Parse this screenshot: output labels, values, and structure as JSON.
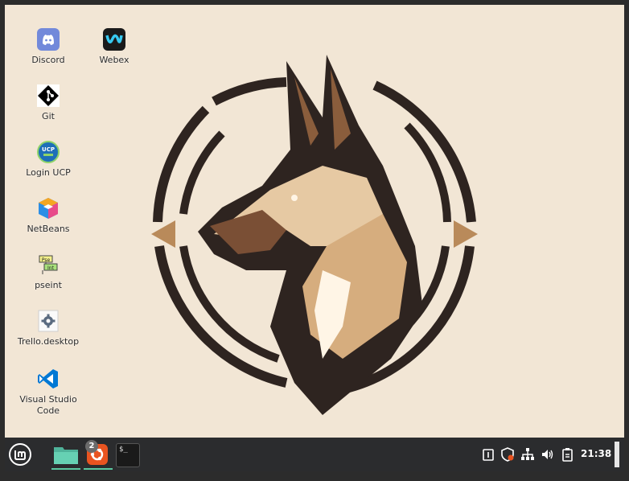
{
  "desktop_icons": [
    {
      "name": "discord-launcher",
      "icon": "discord-icon",
      "label": "Discord"
    },
    {
      "name": "webex-launcher",
      "icon": "webex-icon",
      "label": "Webex"
    },
    {
      "name": "git-launcher",
      "icon": "git-icon",
      "label": "Git"
    },
    {
      "name": "login-ucp-launcher",
      "icon": "ucp-icon",
      "label": "Login UCP"
    },
    {
      "name": "netbeans-launcher",
      "icon": "netbeans-icon",
      "label": "NetBeans"
    },
    {
      "name": "pseint-launcher",
      "icon": "pseint-icon",
      "label": "pseint"
    },
    {
      "name": "trello-launcher",
      "icon": "gear-icon",
      "label": "Trello.desktop"
    },
    {
      "name": "vscode-launcher",
      "icon": "vscode-icon",
      "label": "Visual Studio\nCode"
    }
  ],
  "taskbar": {
    "menu_icon": "linux-mint-icon",
    "apps": [
      {
        "name": "files",
        "icon": "folder-icon"
      },
      {
        "name": "ubuntu-apps",
        "icon": "ubuntu-icon",
        "badge": "2"
      },
      {
        "name": "terminal",
        "icon": "terminal-icon",
        "text": "$_"
      }
    ],
    "tray": [
      "update-manager-icon",
      "shield-icon",
      "network-icon",
      "volume-icon",
      "clipboard-icon"
    ],
    "clock": "21:38"
  },
  "colors": {
    "desktop_bg": "#f2e6d5",
    "panel_bg": "#2b2c2e",
    "accent": "#5bc8a0"
  }
}
